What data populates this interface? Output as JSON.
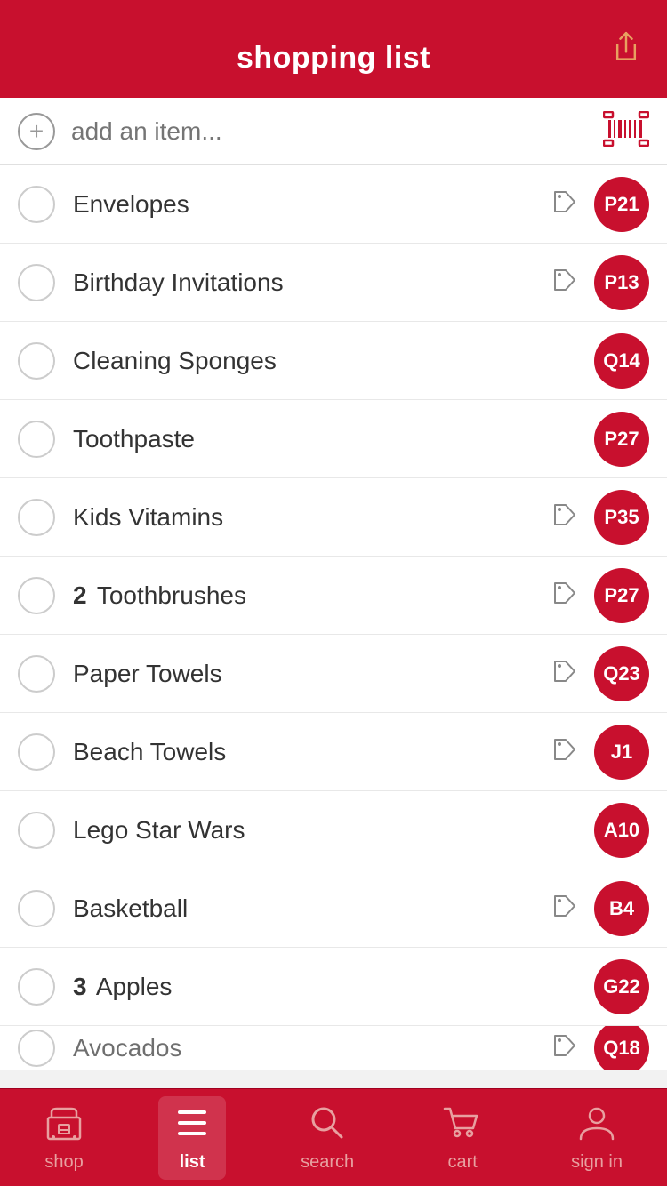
{
  "header": {
    "title": "shopping list"
  },
  "add_item": {
    "placeholder": "add an item...",
    "plus_symbol": "+"
  },
  "items": [
    {
      "id": 1,
      "name": "Envelopes",
      "qty": null,
      "aisle": "P21",
      "has_tag": true
    },
    {
      "id": 2,
      "name": "Birthday Invitations",
      "qty": null,
      "aisle": "P13",
      "has_tag": true
    },
    {
      "id": 3,
      "name": "Cleaning Sponges",
      "qty": null,
      "aisle": "Q14",
      "has_tag": false
    },
    {
      "id": 4,
      "name": "Toothpaste",
      "qty": null,
      "aisle": "P27",
      "has_tag": false
    },
    {
      "id": 5,
      "name": "Kids Vitamins",
      "qty": null,
      "aisle": "P35",
      "has_tag": true
    },
    {
      "id": 6,
      "name": "Toothbrushes",
      "qty": "2",
      "aisle": "P27",
      "has_tag": true
    },
    {
      "id": 7,
      "name": "Paper Towels",
      "qty": null,
      "aisle": "Q23",
      "has_tag": true
    },
    {
      "id": 8,
      "name": "Beach Towels",
      "qty": null,
      "aisle": "J1",
      "has_tag": true
    },
    {
      "id": 9,
      "name": "Lego Star Wars",
      "qty": null,
      "aisle": "A10",
      "has_tag": false
    },
    {
      "id": 10,
      "name": "Basketball",
      "qty": null,
      "aisle": "B4",
      "has_tag": true
    },
    {
      "id": 11,
      "name": "Apples",
      "qty": "3",
      "aisle": "G22",
      "has_tag": false
    },
    {
      "id": 12,
      "name": "Avocados",
      "qty": null,
      "aisle": "Q18",
      "has_tag": true
    }
  ],
  "nav": {
    "items": [
      {
        "id": "shop",
        "label": "shop",
        "active": false
      },
      {
        "id": "list",
        "label": "list",
        "active": true
      },
      {
        "id": "search",
        "label": "search",
        "active": false
      },
      {
        "id": "cart",
        "label": "cart",
        "active": false
      },
      {
        "id": "sign-in",
        "label": "sign in",
        "active": false
      }
    ]
  },
  "colors": {
    "brand_red": "#c8102e",
    "inactive_nav": "#e8a0a0",
    "active_nav": "#ffffff"
  }
}
